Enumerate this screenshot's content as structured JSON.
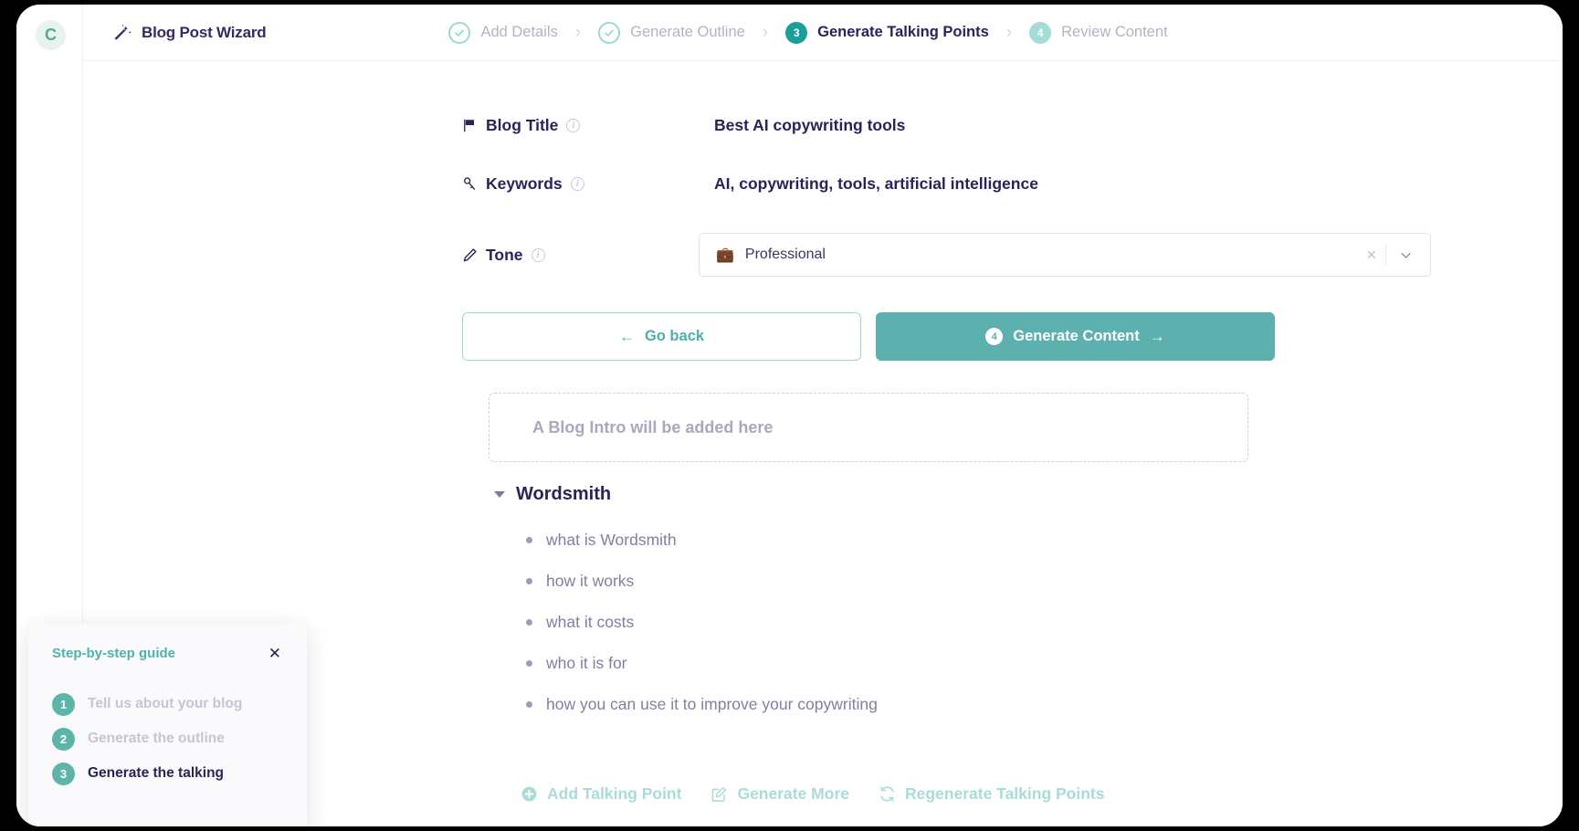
{
  "window": {
    "avatar_initial": "C"
  },
  "header": {
    "title": "Blog Post Wizard",
    "wand_icon": "magic-wand-icon",
    "steps": [
      {
        "marker": "check",
        "label": "Add Details",
        "state": "done"
      },
      {
        "marker": "check",
        "label": "Generate Outline",
        "state": "done"
      },
      {
        "marker": "3",
        "label": "Generate Talking Points",
        "state": "current"
      },
      {
        "marker": "4",
        "label": "Review Content",
        "state": "upcoming"
      }
    ],
    "separator": "›"
  },
  "fields": {
    "blog_title": {
      "label": "Blog Title",
      "icon": "flag-icon",
      "info": "i",
      "value": "Best AI copywriting tools"
    },
    "keywords": {
      "label": "Keywords",
      "icon": "key-icon",
      "info": "i",
      "value": "AI, copywriting, tools, artificial intelligence"
    },
    "tone": {
      "label": "Tone",
      "icon": "pen-icon",
      "info": "i",
      "emoji": "💼",
      "value": "Professional",
      "clear_glyph": "×",
      "chevron": "chevron-down-icon"
    }
  },
  "buttons": {
    "go_back": {
      "label": "Go back",
      "arrow": "←"
    },
    "generate": {
      "badge": "4",
      "label": "Generate Content",
      "arrow": "→"
    }
  },
  "intro_placeholder": {
    "text": "A Blog Intro will be added here"
  },
  "outline": {
    "section_title": "Wordsmith",
    "bullets": [
      "what is Wordsmith",
      "how it works",
      "what it costs",
      "who it is for",
      "how you can use it to improve your copywriting"
    ]
  },
  "talking_point_actions": [
    {
      "label": "Add Talking Point",
      "icon": "plus-circle-icon"
    },
    {
      "label": "Generate More",
      "icon": "edit-square-icon"
    },
    {
      "label": "Regenerate Talking Points",
      "icon": "refresh-icon"
    }
  ],
  "guide": {
    "title": "Step-by-step guide",
    "close_glyph": "✕",
    "items": [
      {
        "num": "1",
        "label": "Tell us about your blog",
        "active": false
      },
      {
        "num": "2",
        "label": "Generate the outline",
        "active": false
      },
      {
        "num": "3",
        "label": "Generate the talking",
        "active": true
      }
    ]
  },
  "colors": {
    "accent_teal": "#5cb1ae",
    "accent_teal_dark": "#1a9e9a",
    "accent_teal_light": "#a3ddd7",
    "navy": "#2c2259",
    "muted": "#b3b2c6"
  }
}
